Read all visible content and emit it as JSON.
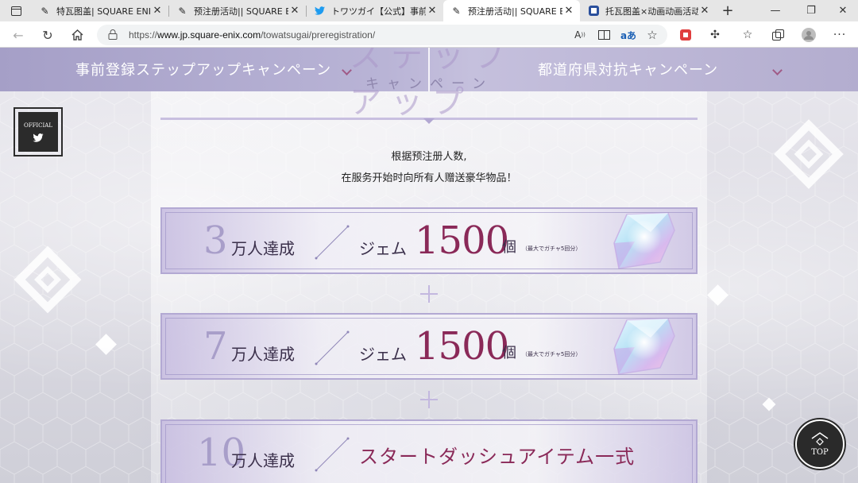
{
  "browser": {
    "tabs": [
      {
        "title": "特瓦图盖| SQUARE ENIX",
        "icon": "pen-icon"
      },
      {
        "title": "预注册活动|| SQUARE ENIX",
        "icon": "pen-icon"
      },
      {
        "title": "トワツガイ【公式】事前登",
        "icon": "twitter-bird-icon"
      },
      {
        "title": "预注册活动|| SQUARE ENIX",
        "icon": "pen-icon"
      },
      {
        "title": "托瓦图盖×动画动画活动第",
        "icon": "doc-icon"
      }
    ],
    "active_tab": 3,
    "url_prefix": "https://",
    "url_host": "www.jp.square-enix.com",
    "url_path": "/towatsugai/preregistration/"
  },
  "page": {
    "nav": {
      "left_label": "事前登録ステップアップキャンペーン",
      "right_label": "都道府県対抗キャンペーン",
      "center_sub": "キャンペーン",
      "center_deco": "ステップアップ"
    },
    "official": {
      "label": "OFFICIAL"
    },
    "description": {
      "line1": "根据预注册人数,",
      "line2": "在服务开始时向所有人赠送豪华物品！"
    },
    "rewards": [
      {
        "num": "3",
        "unit": "万人達成",
        "item": "ジェム",
        "amount": "1500",
        "count": "個",
        "note": "（最大でガチャ5回分）"
      },
      {
        "num": "7",
        "unit": "万人達成",
        "item": "ジェム",
        "amount": "1500",
        "count": "個",
        "note": "（最大でガチャ5回分）"
      },
      {
        "num": "10",
        "unit": "万人達成",
        "bonus": "スタートダッシュアイテム一式"
      }
    ],
    "top_button": "TOP"
  },
  "colors": {
    "accent": "#8a2958",
    "lavender": "#b3a9d3",
    "nav": "#b9b4d6"
  }
}
